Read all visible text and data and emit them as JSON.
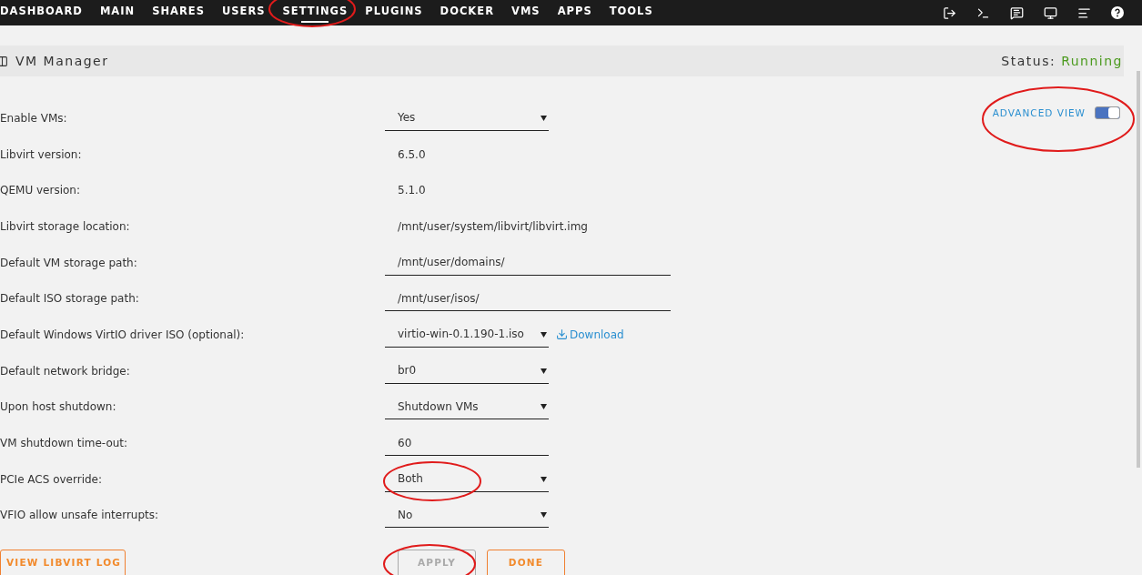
{
  "nav": {
    "tabs": [
      {
        "label": "DASHBOARD",
        "selected": false,
        "highlighted": false
      },
      {
        "label": "MAIN",
        "selected": false,
        "highlighted": false
      },
      {
        "label": "SHARES",
        "selected": false,
        "highlighted": false
      },
      {
        "label": "USERS",
        "selected": false,
        "highlighted": false
      },
      {
        "label": "SETTINGS",
        "selected": true,
        "highlighted": true
      },
      {
        "label": "PLUGINS",
        "selected": false,
        "highlighted": false
      },
      {
        "label": "DOCKER",
        "selected": false,
        "highlighted": false
      },
      {
        "label": "VMS",
        "selected": false,
        "highlighted": false
      },
      {
        "label": "APPS",
        "selected": false,
        "highlighted": false
      },
      {
        "label": "TOOLS",
        "selected": false,
        "highlighted": false
      }
    ]
  },
  "header": {
    "title": "VM Manager",
    "status_label": "Status:",
    "status": "Running"
  },
  "advanced_view": {
    "label": "ADVANCED VIEW",
    "on": true,
    "highlighted": true
  },
  "settings": [
    {
      "label": "Enable VMs:",
      "kind": "select",
      "value": "Yes",
      "highlighted": false
    },
    {
      "label": "Libvirt version:",
      "kind": "text",
      "value": "6.5.0",
      "highlighted": false
    },
    {
      "label": "QEMU version:",
      "kind": "text",
      "value": "5.1.0",
      "highlighted": false
    },
    {
      "label": "Libvirt storage location:",
      "kind": "text",
      "value": "/mnt/user/system/libvirt/libvirt.img",
      "highlighted": false
    },
    {
      "label": "Default VM storage path:",
      "kind": "input",
      "value": "/mnt/user/domains/",
      "highlighted": false
    },
    {
      "label": "Default ISO storage path:",
      "kind": "input",
      "value": "/mnt/user/isos/",
      "highlighted": false
    },
    {
      "label": "Default Windows VirtIO driver ISO (optional):",
      "kind": "select",
      "value": "virtio-win-0.1.190-1.iso",
      "link": "Download",
      "highlighted": false
    },
    {
      "label": "Default network bridge:",
      "kind": "select",
      "value": "br0",
      "highlighted": false
    },
    {
      "label": "Upon host shutdown:",
      "kind": "select",
      "value": "Shutdown VMs",
      "highlighted": false
    },
    {
      "label": "VM shutdown time-out:",
      "kind": "input-short",
      "value": "60",
      "highlighted": false
    },
    {
      "label": "PCIe ACS override:",
      "kind": "select",
      "value": "Both",
      "highlighted": true
    },
    {
      "label": "VFIO allow unsafe interrupts:",
      "kind": "select",
      "value": "No",
      "highlighted": false
    }
  ],
  "buttons": [
    {
      "label": "VIEW LIBVIRT LOG",
      "disabled": false,
      "highlighted": false
    },
    {
      "label": "APPLY",
      "disabled": true,
      "highlighted": true
    },
    {
      "label": "DONE",
      "disabled": false,
      "highlighted": false
    }
  ]
}
